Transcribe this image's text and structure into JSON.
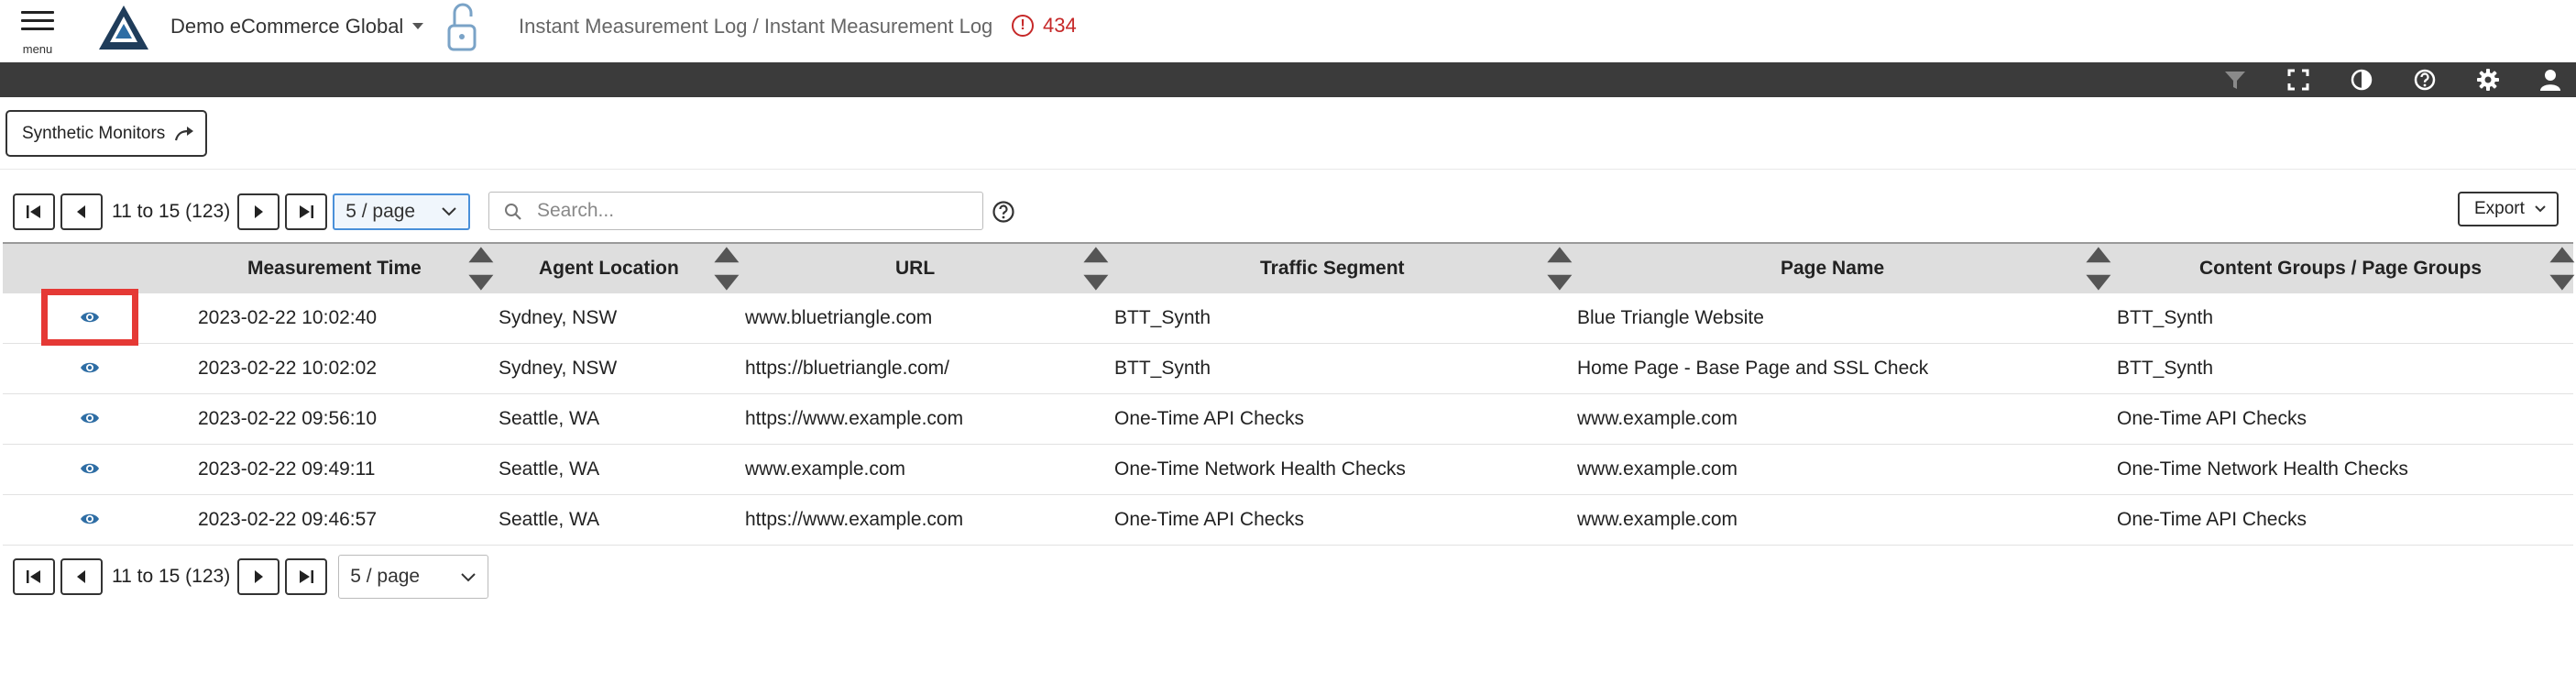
{
  "header": {
    "menu_label": "menu",
    "org_name": "Demo eCommerce Global",
    "breadcrumb": "Instant Measurement Log / Instant Measurement Log",
    "alert_count": "434"
  },
  "toolbar_icons": [
    "filter-icon",
    "fullscreen-icon",
    "contrast-icon",
    "help-icon",
    "gear-icon",
    "user-icon"
  ],
  "synthetic_monitors_label": "Synthetic Monitors",
  "pager_top": {
    "range_text": "11 to 15 (123)",
    "page_size": "5 / page"
  },
  "pager_bottom": {
    "range_text": "11 to 15 (123)",
    "page_size": "5 / page"
  },
  "search": {
    "placeholder": "Search..."
  },
  "export_label": "Export",
  "table": {
    "columns": [
      "Measurement Time",
      "Agent Location",
      "URL",
      "Traffic Segment",
      "Page Name",
      "Content Groups / Page Groups"
    ],
    "rows": [
      [
        "2023-02-22 10:02:40",
        "Sydney, NSW",
        "www.bluetriangle.com",
        "BTT_Synth",
        "Blue Triangle Website",
        "BTT_Synth"
      ],
      [
        "2023-02-22 10:02:02",
        "Sydney, NSW",
        "https://bluetriangle.com/",
        "BTT_Synth",
        "Home Page - Base Page and SSL Check",
        "BTT_Synth"
      ],
      [
        "2023-02-22 09:56:10",
        "Seattle, WA",
        "https://www.example.com",
        "One-Time API Checks",
        "www.example.com",
        "One-Time API Checks"
      ],
      [
        "2023-02-22 09:49:11",
        "Seattle, WA",
        "www.example.com",
        "One-Time Network Health Checks",
        "www.example.com",
        "One-Time Network Health Checks"
      ],
      [
        "2023-02-22 09:46:57",
        "Seattle, WA",
        "https://www.example.com",
        "One-Time API Checks",
        "www.example.com",
        "One-Time API Checks"
      ]
    ]
  },
  "colors": {
    "alert": "#c62828",
    "toolbar_bg": "#3b3b3b",
    "header_bg": "#dedede",
    "eye_icon": "#2e6da4",
    "highlight": "#e53935"
  }
}
